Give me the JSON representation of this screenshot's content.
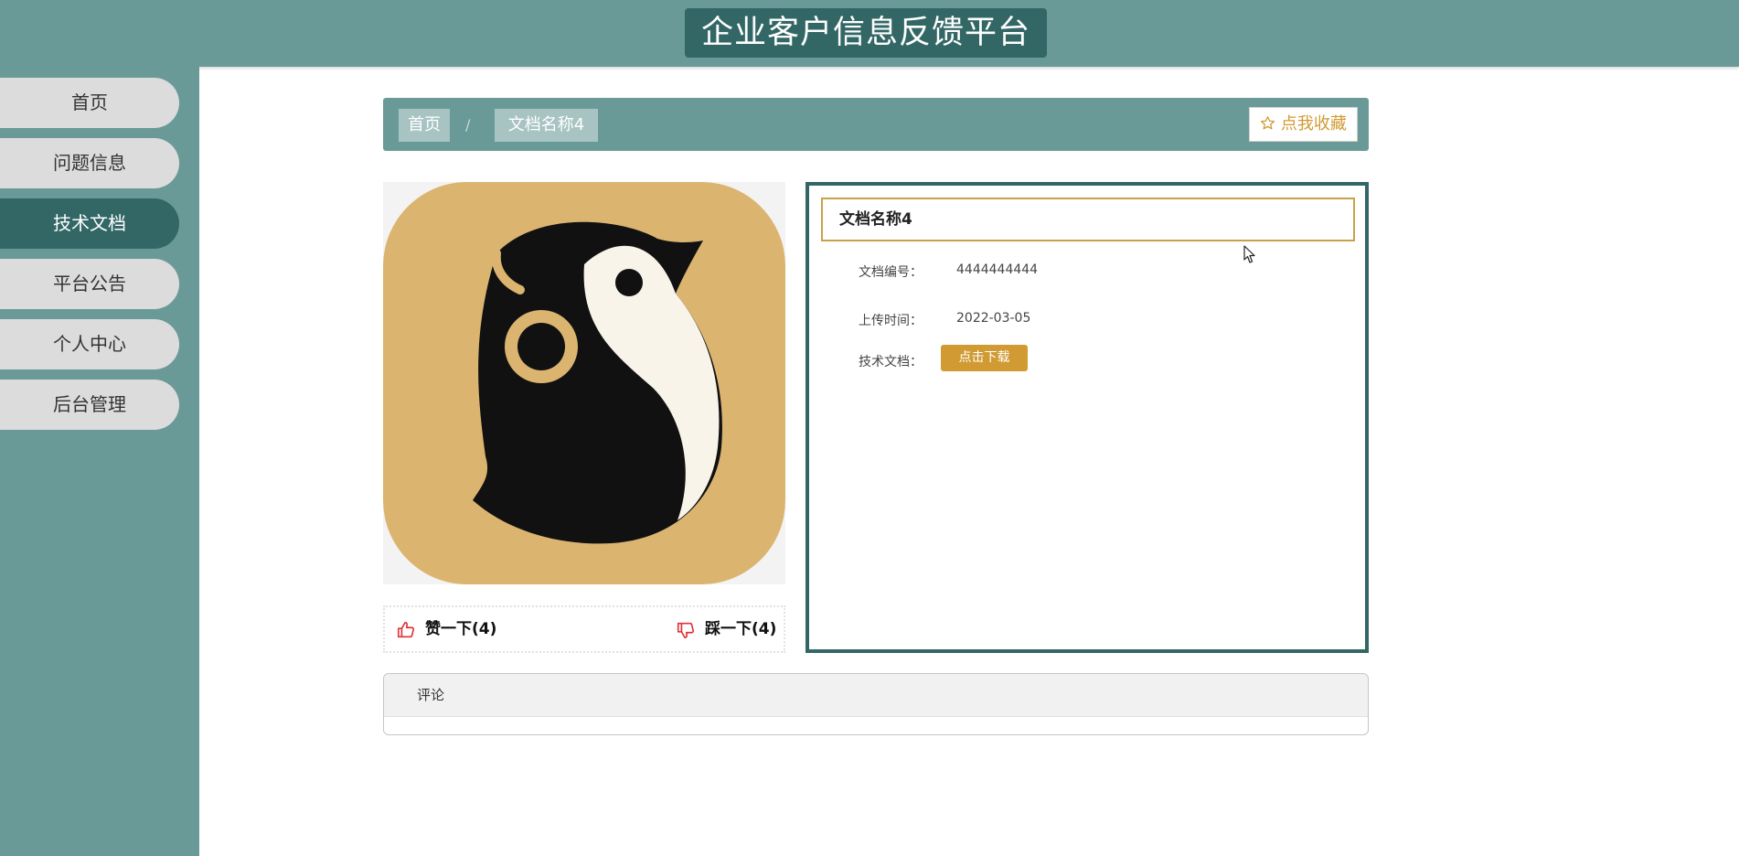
{
  "header": {
    "title": "企业客户信息反馈平台"
  },
  "sidebar": {
    "items": [
      {
        "label": "首页",
        "active": false
      },
      {
        "label": "问题信息",
        "active": false
      },
      {
        "label": "技术文档",
        "active": true
      },
      {
        "label": "平台公告",
        "active": false
      },
      {
        "label": "个人中心",
        "active": false
      },
      {
        "label": "后台管理",
        "active": false
      }
    ]
  },
  "breadcrumb": {
    "home": "首页",
    "separator": "/",
    "current": "文档名称4",
    "favorite_label": "点我收藏",
    "favorite_icon": "star-outline-icon"
  },
  "document": {
    "name": "文档名称4",
    "image_icon": "penguin-app-icon",
    "fields": [
      {
        "label": "文档编号：",
        "value": "4444444444"
      },
      {
        "label": "上传时间：",
        "value": "2022-03-05"
      }
    ],
    "file_label": "技术文档：",
    "download_label": "点击下载"
  },
  "votes": {
    "like_label": "赞一下(4)",
    "dislike_label": "踩一下(4)"
  },
  "comments": {
    "title": "评论"
  },
  "colors": {
    "primary": "#6a9a98",
    "dark": "#326766",
    "accent": "#d19a32",
    "icon_red": "#e0333a"
  }
}
